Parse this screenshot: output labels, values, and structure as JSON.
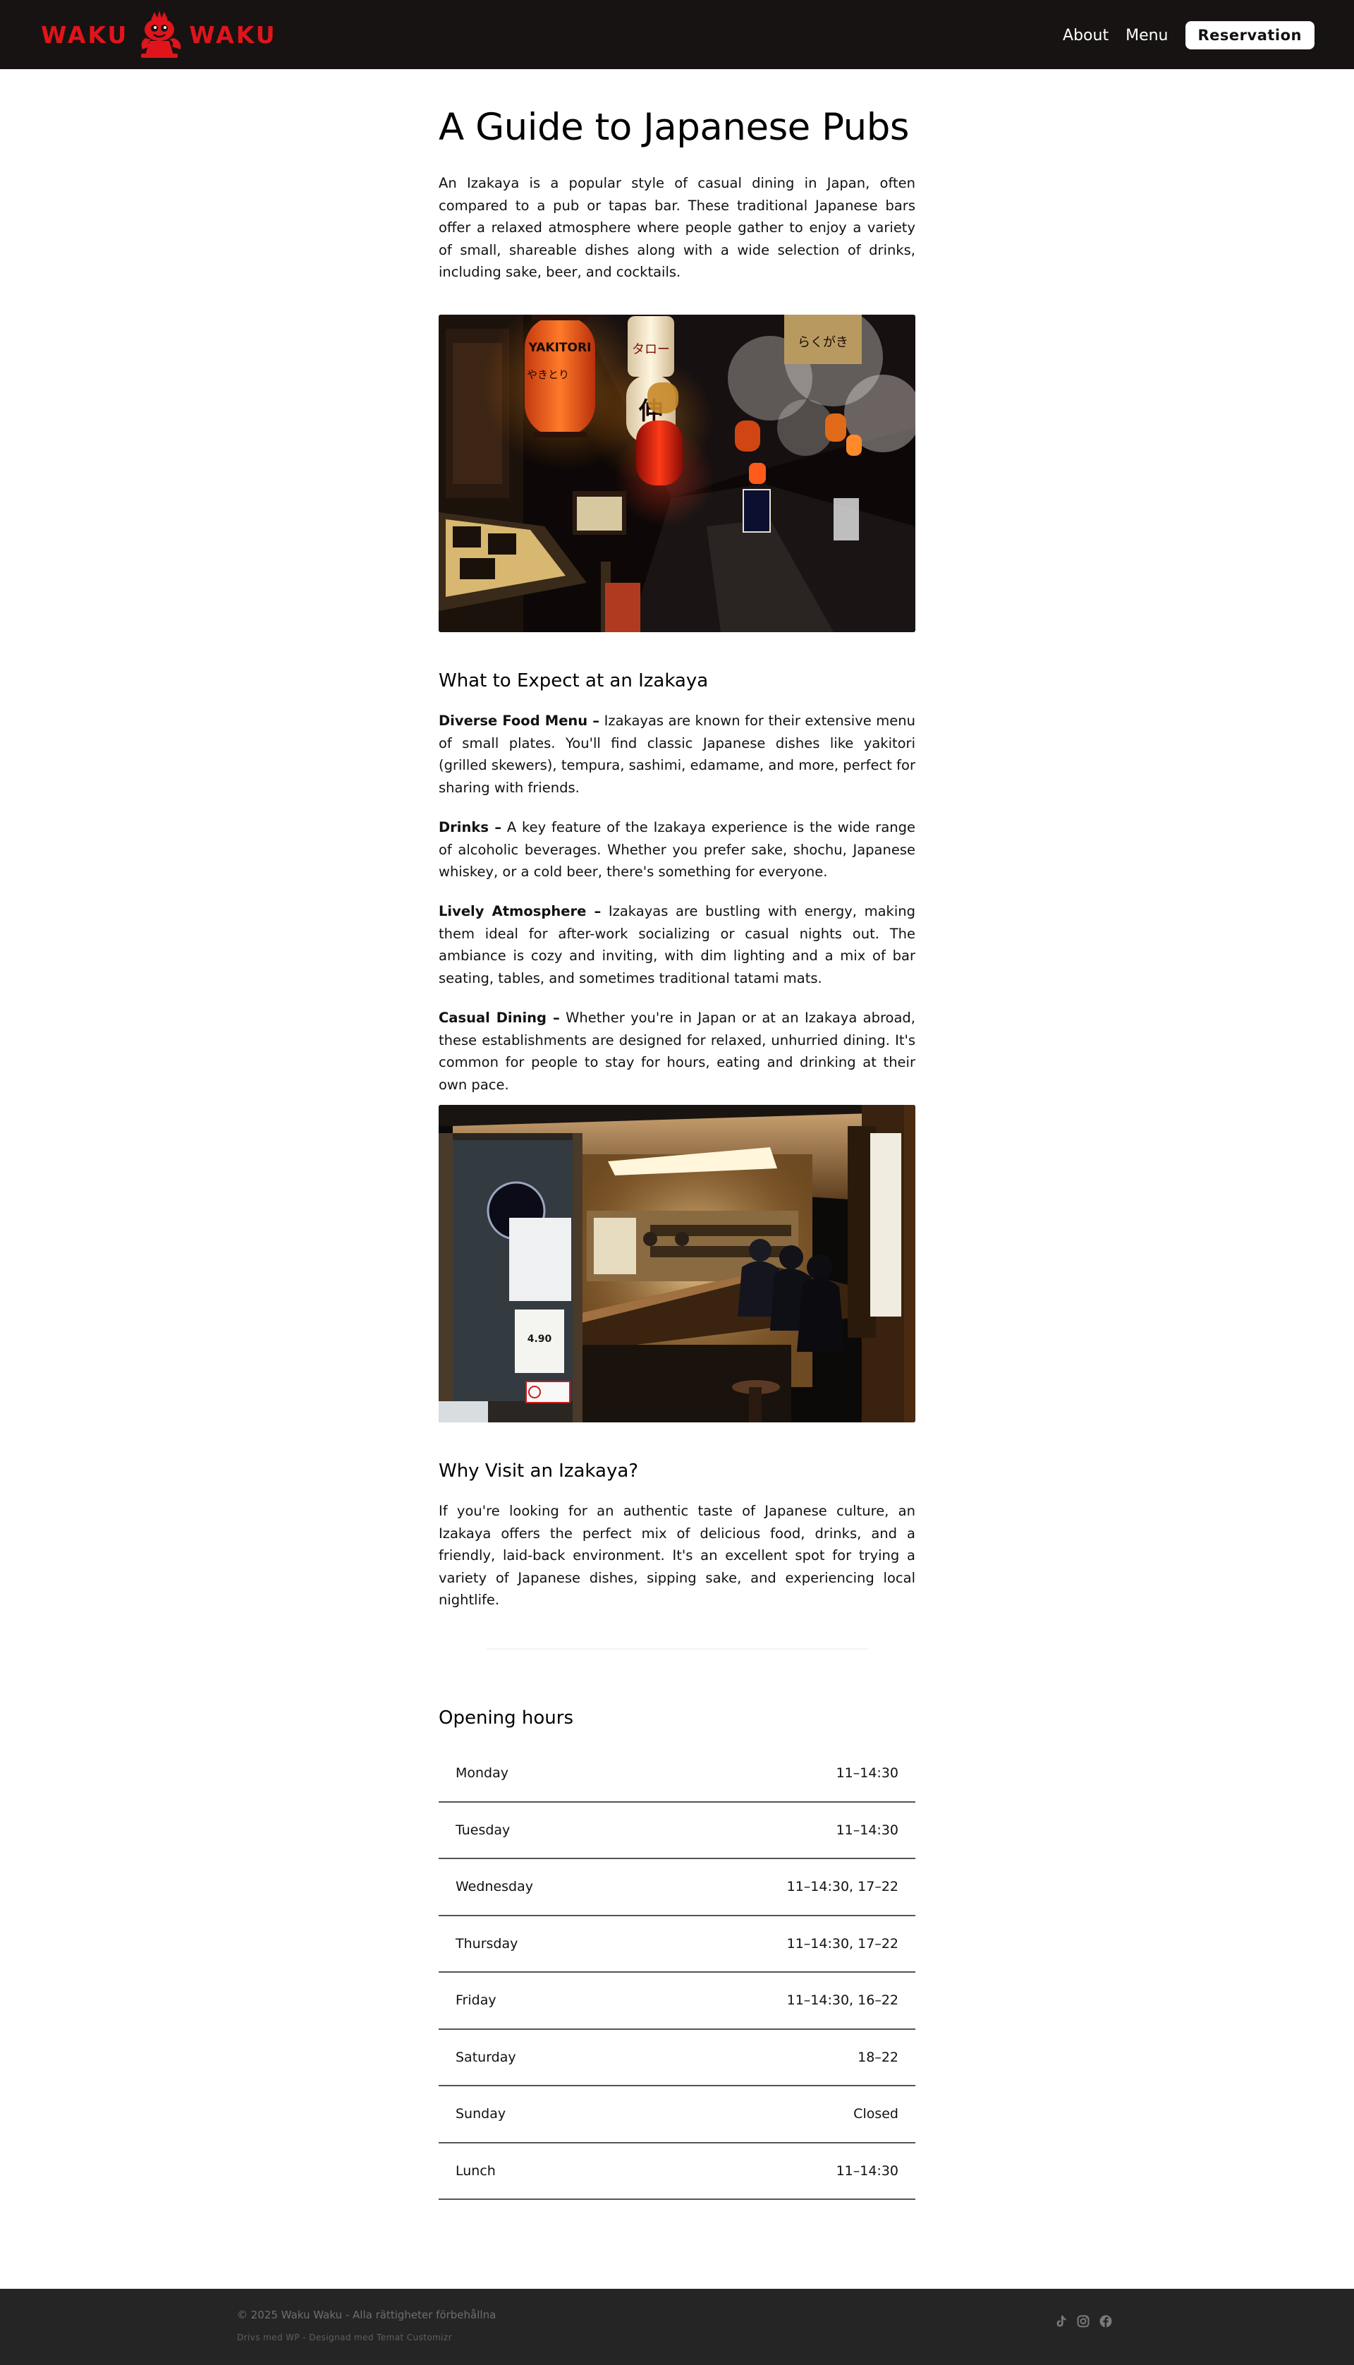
{
  "brand": {
    "logo_left": "WAKU",
    "logo_right": "WAKU",
    "accent": "#e0141b",
    "header_bg": "#171312"
  },
  "nav": {
    "items": [
      "About",
      "Menu"
    ],
    "reservation": "Reservation"
  },
  "article": {
    "title": "A Guide to Japanese Pubs",
    "intro": "An Izakaya is a popular style of casual dining in Japan, often compared to a pub or tapas bar. These traditional Japanese bars offer a relaxed atmosphere where people gather to enjoy a variety of small, shareable dishes along with a wide selection of drinks, including sake, beer, and cocktails.",
    "section1_heading": "What to Expect at an Izakaya",
    "features": [
      {
        "label": "Diverse Food Menu –",
        "text": " Izakayas are known for their extensive menu of small plates. You'll find classic Japanese dishes like yakitori (grilled skewers), tempura, sashimi, edamame, and more, perfect for sharing with friends."
      },
      {
        "label": "Drinks –",
        "text": " A key feature of the Izakaya experience is the wide range of alcoholic beverages. Whether you prefer sake, shochu, Japanese whiskey, or a cold beer, there's something for everyone."
      },
      {
        "label": "Lively Atmosphere –",
        "text": " Izakayas are bustling with energy, making them ideal for after-work socializing or casual nights out. The ambiance is cozy and inviting, with dim lighting and a mix of bar seating, tables, and sometimes traditional tatami mats."
      },
      {
        "label": "Casual Dining –",
        "text": " Whether you're in Japan or at an Izakaya abroad, these establishments are designed for relaxed, unhurried dining. It's common for people to stay for hours, eating and drinking at their own pace."
      }
    ],
    "section2_heading": "Why Visit an Izakaya?",
    "why_text": "If you're looking for an authentic taste of Japanese culture, an Izakaya offers the perfect mix of delicious food, drinks, and a friendly, laid-back environment. It's an excellent spot for trying a variety of Japanese dishes, sipping sake, and experiencing local nightlife.",
    "photo1_signs": [
      "YAKITORI",
      "やきとり",
      "タロー",
      "伸",
      "らくがき"
    ],
    "photo2_signs": [
      "4.90"
    ]
  },
  "hours": {
    "title": "Opening hours",
    "rows": [
      {
        "day": "Monday",
        "time": "11–14:30"
      },
      {
        "day": "Tuesday",
        "time": "11–14:30"
      },
      {
        "day": "Wednesday",
        "time": "11–14:30, 17–22"
      },
      {
        "day": "Thursday",
        "time": "11–14:30, 17–22"
      },
      {
        "day": "Friday",
        "time": "11–14:30, 16–22"
      },
      {
        "day": "Saturday",
        "time": "18–22"
      },
      {
        "day": "Sunday",
        "time": "Closed"
      },
      {
        "day": "Lunch",
        "time": "11–14:30"
      }
    ]
  },
  "footer": {
    "copyright": "© 2025 Waku Waku - Alla rättigheter förbehållna",
    "credit": "Drivs med WP - Designad med Temat Customizr",
    "socials": [
      "tiktok-icon",
      "instagram-icon",
      "facebook-icon"
    ]
  }
}
